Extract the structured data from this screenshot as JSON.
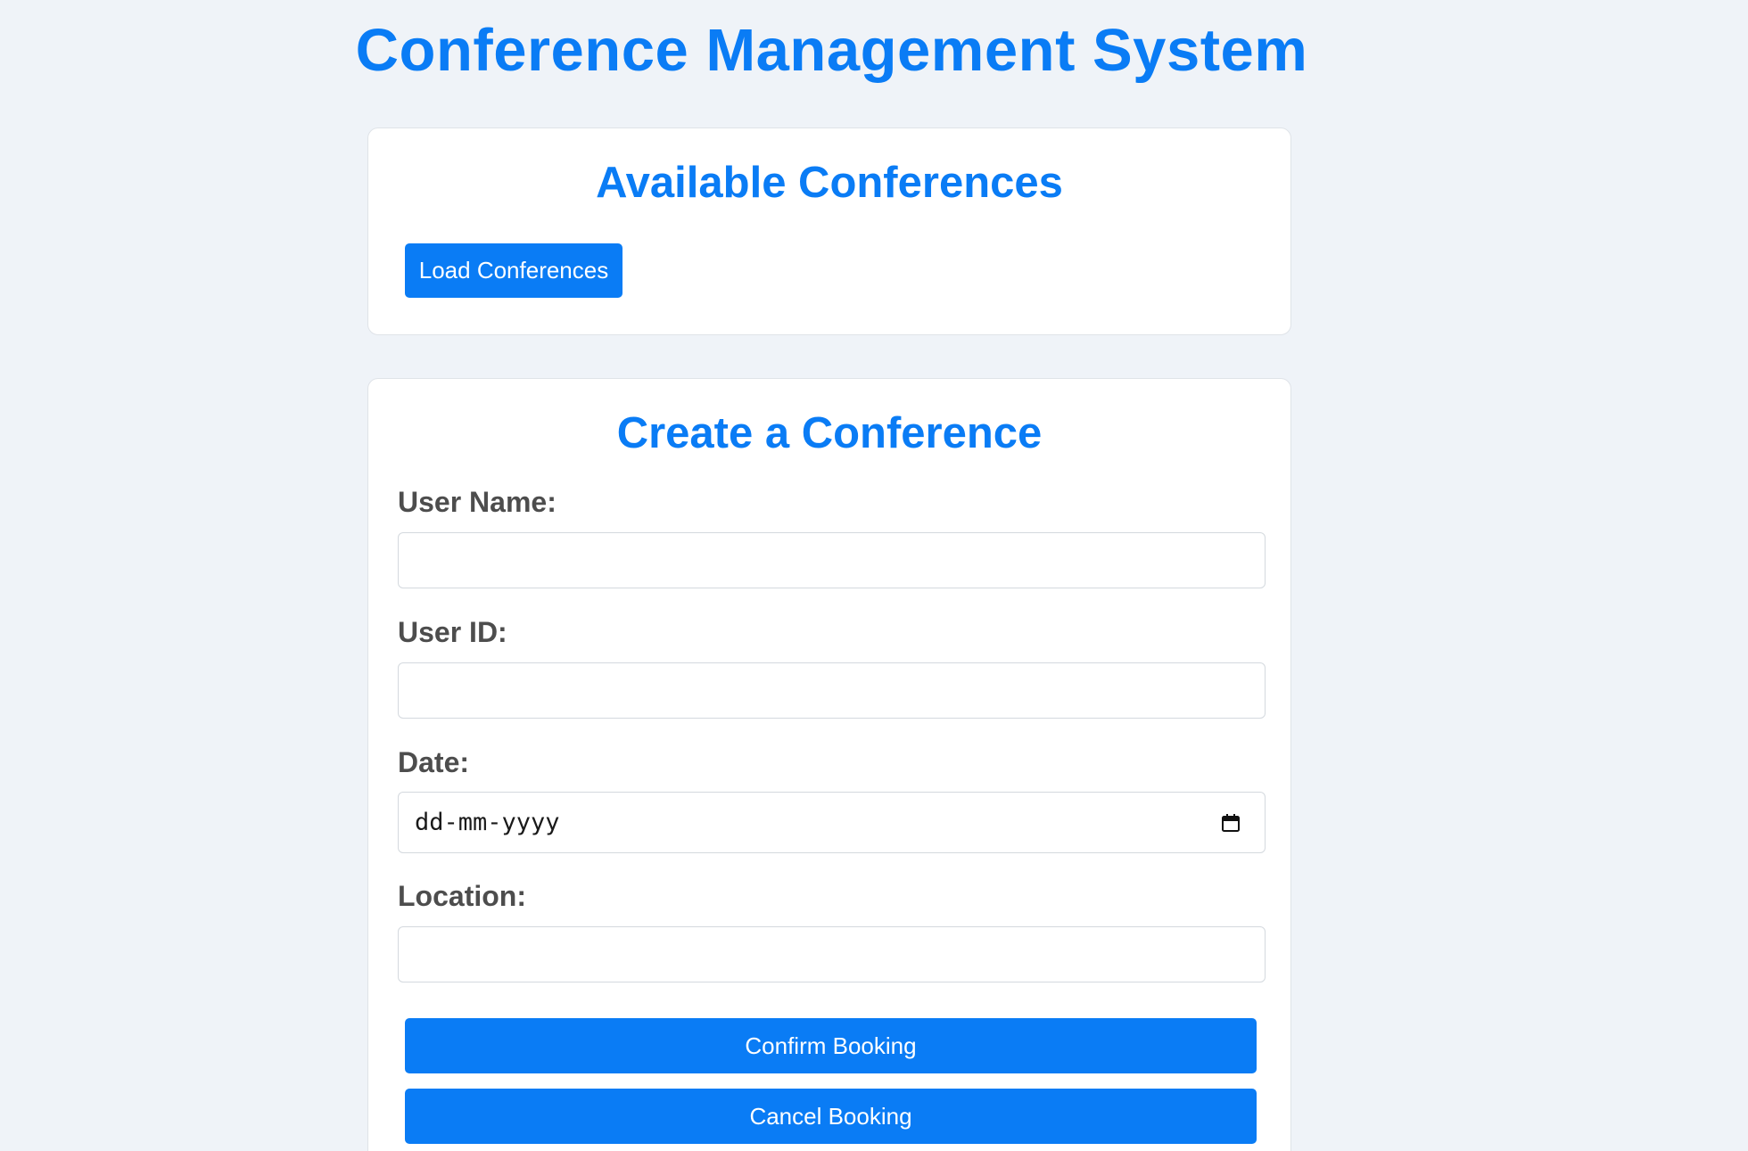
{
  "app": {
    "title": "Conference Management System"
  },
  "conferences": {
    "title": "Available Conferences",
    "load_button": "Load Conferences"
  },
  "create": {
    "title": "Create a Conference",
    "fields": {
      "user_name": {
        "label": "User Name:",
        "value": ""
      },
      "user_id": {
        "label": "User ID:",
        "value": ""
      },
      "date": {
        "label": "Date:",
        "placeholder": "dd-mm-yyyy",
        "icon": "calendar-icon"
      },
      "location": {
        "label": "Location:",
        "value": ""
      }
    },
    "confirm_button": "Confirm Booking",
    "cancel_button": "Cancel Booking"
  },
  "colors": {
    "accent": "#0a7cf5",
    "background": "#eff3f8",
    "label_text": "#4d4d4d"
  }
}
